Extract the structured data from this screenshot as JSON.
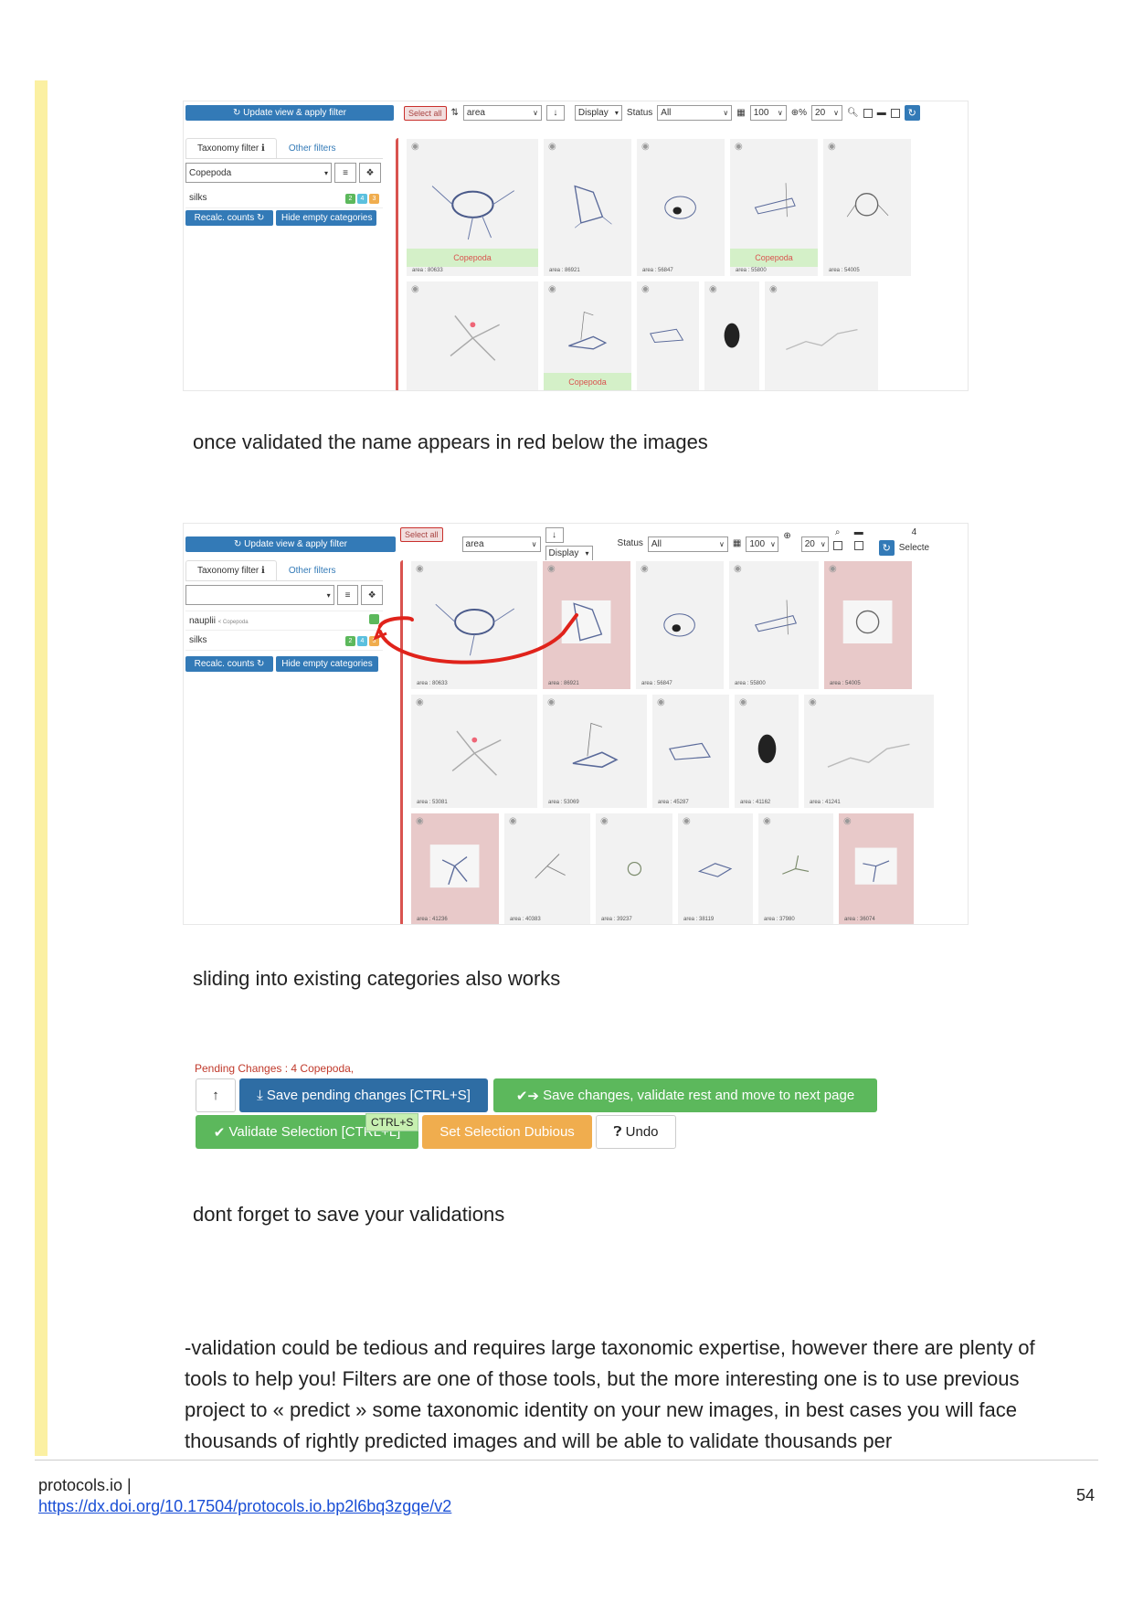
{
  "captions": {
    "first": "once validated the name appears in red below the images",
    "second": "sliding into existing categories also works",
    "third": "dont forget to save your validations"
  },
  "paragraph": "-validation could be tedious and requires large taxonomic expertise, however there are plenty of tools to help you! Filters are one of those tools, but the more interesting one is to use previous project to « predict » some taxonomic identity on your new images, in best cases you will face thousands of rightly predicted images and will be able to validate thousands per",
  "footer": {
    "site": "protocols.io |",
    "link": "https://dx.doi.org/10.17504/protocols.io.bp2l6bq3zgqe/v2",
    "page": "54"
  },
  "shot1": {
    "update": "Update view & apply filter",
    "select_all": "Select all",
    "sort": "area",
    "display": "Display",
    "status_label": "Status",
    "status": "All",
    "per_page": "100",
    "zoom": "20",
    "tab_taxonomy": "Taxonomy filter",
    "tab_other": "Other filters",
    "taxon": "Copepoda",
    "cat1": "silks",
    "cat1_badges": [
      "2",
      "4",
      "3"
    ],
    "recalc": "Recalc. counts",
    "hide_empty": "Hide empty categories",
    "row1": [
      {
        "label": "Copepoda",
        "area": "area : 80633"
      },
      {
        "label": "",
        "area": "area : 86921"
      },
      {
        "label": "",
        "area": "area : 56847"
      },
      {
        "label": "Copepoda",
        "area": "area : 55800"
      },
      {
        "label": "",
        "area": "area : 54005"
      }
    ],
    "row2": [
      {
        "label": "",
        "area": ""
      },
      {
        "label": "Copepoda",
        "area": ""
      },
      {
        "label": "",
        "area": ""
      },
      {
        "label": "",
        "area": ""
      },
      {
        "label": "",
        "area": ""
      }
    ]
  },
  "shot2": {
    "update": "Update view & apply filter",
    "select_all": "Select all",
    "sort": "area",
    "display": "Display",
    "status_label": "Status",
    "status": "All",
    "per_page": "100",
    "zoom": "20",
    "selected_count": "4",
    "selected_label": "Selecte",
    "tab_taxonomy": "Taxonomy filter",
    "tab_other": "Other filters",
    "cat1": "nauplii",
    "cat1_parent": "< Copepoda",
    "cat2": "silks",
    "cat2_badges": [
      "2",
      "4",
      "3"
    ],
    "recalc": "Recalc. counts",
    "hide_empty": "Hide empty categories",
    "row1": [
      "area : 80633",
      "area : 86921",
      "area : 56847",
      "area : 55800",
      "area : 54005"
    ],
    "row2": [
      "area : 53081",
      "area : 53069",
      "area : 45287",
      "area : 41162",
      "area : 41241"
    ],
    "row3": [
      "area : 41236",
      "area : 40383",
      "area : 39237",
      "area : 38119",
      "area : 37980",
      "area : 36074"
    ]
  },
  "shot3": {
    "pending": "Pending Changes : 4 Copepoda,",
    "save_pending": "Save pending changes [CTRL+S]",
    "save_validate": "Save changes, validate rest and move to next page",
    "validate_sel": "Validate Selection [CTRL+L]",
    "tooltip": "CTRL+S",
    "dubious": "Set Selection Dubious",
    "undo": "Undo"
  },
  "colors": {
    "highlight_bar": "#fbf0a2",
    "primary": "#337ab7",
    "success": "#5cb85c",
    "warning": "#f0ad4e",
    "danger": "#d9534f",
    "arrow": "#e0231b"
  }
}
